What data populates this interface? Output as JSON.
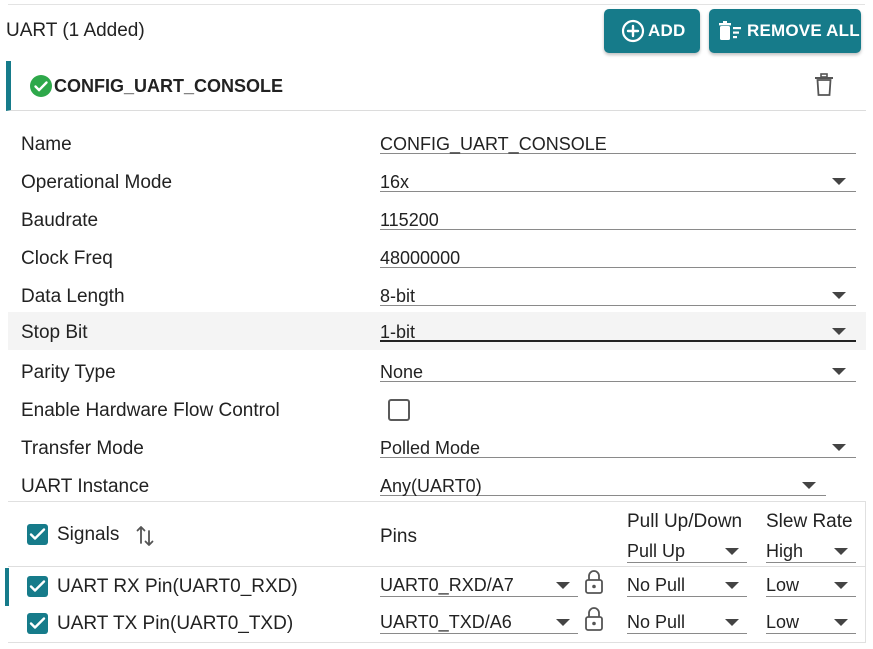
{
  "header": {
    "title": "UART (1 Added)",
    "add_label": "ADD",
    "remove_all_label": "REMOVE ALL"
  },
  "config": {
    "name": "CONFIG_UART_CONSOLE",
    "status_icon": "check-circle-icon",
    "delete_icon": "trash-icon"
  },
  "properties": [
    {
      "label": "Name",
      "value": "CONFIG_UART_CONSOLE",
      "type": "text"
    },
    {
      "label": "Operational Mode",
      "value": "16x",
      "type": "select"
    },
    {
      "label": "Baudrate",
      "value": "115200",
      "type": "text"
    },
    {
      "label": "Clock Freq",
      "value": "48000000",
      "type": "text"
    },
    {
      "label": "Data Length",
      "value": "8-bit",
      "type": "select"
    },
    {
      "label": "Stop Bit",
      "value": "1-bit",
      "type": "select"
    },
    {
      "label": "Parity Type",
      "value": "None",
      "type": "select"
    },
    {
      "label": "Enable Hardware Flow Control",
      "value": "",
      "type": "checkbox",
      "checked": false
    },
    {
      "label": "Transfer Mode",
      "value": "Polled Mode",
      "type": "select"
    },
    {
      "label": "UART Instance",
      "value": "Any(UART0)",
      "type": "select"
    }
  ],
  "signals": {
    "header": {
      "signals_label": "Signals",
      "pins_label": "Pins",
      "pull_label": "Pull Up/Down",
      "pull_value": "Pull Up",
      "slew_label": "Slew Rate",
      "slew_value": "High"
    },
    "rows": [
      {
        "name": "UART RX Pin(UART0_RXD)",
        "pin": "UART0_RXD/A7",
        "pull": "No Pull",
        "slew": "Low",
        "checked": true
      },
      {
        "name": "UART TX Pin(UART0_TXD)",
        "pin": "UART0_TXD/A6",
        "pull": "No Pull",
        "slew": "Low",
        "checked": true
      }
    ]
  },
  "colors": {
    "accent": "#167b8a",
    "success": "#2ea84a"
  }
}
